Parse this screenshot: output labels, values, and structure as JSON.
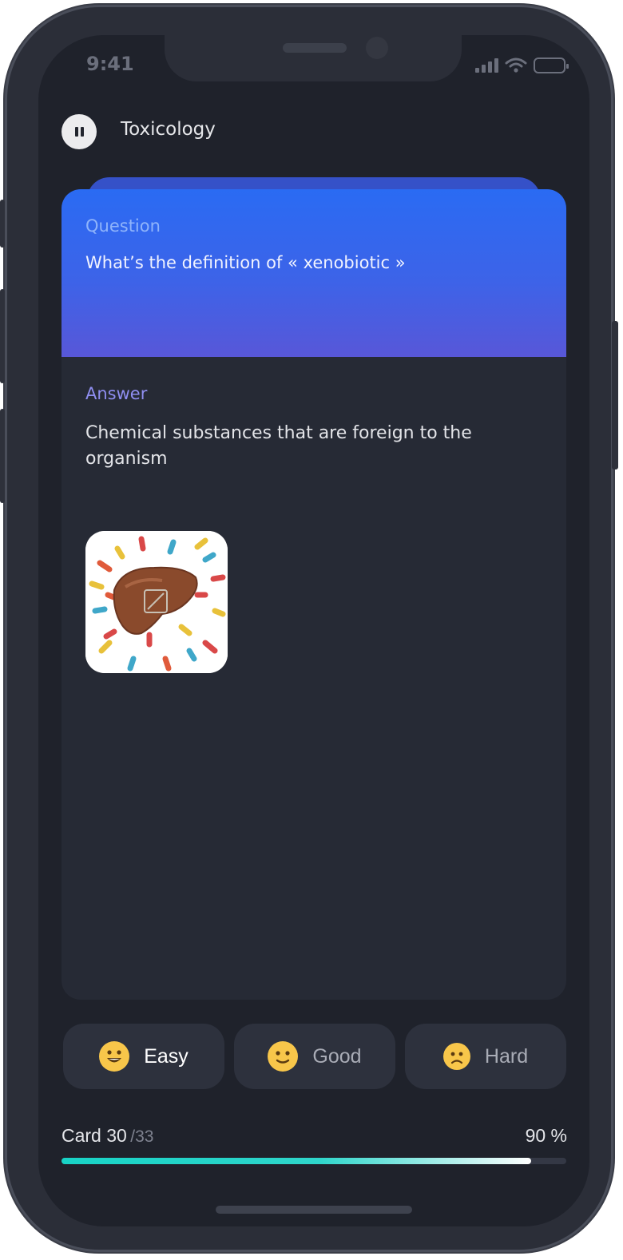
{
  "status_bar": {
    "time": "9:41",
    "icons": [
      "cellular-signal-icon",
      "wifi-icon",
      "battery-icon"
    ]
  },
  "header": {
    "pause_icon": "pause-icon",
    "deck_title": "Toxicology"
  },
  "card": {
    "question_label": "Question",
    "question_text": "What’s the definition of « xenobiotic »",
    "answer_label": "Answer",
    "answer_text": "Chemical substances that are foreign to the organism",
    "image_icon": "liver-with-pills-image"
  },
  "ratings": [
    {
      "label": "Easy",
      "icon": "grinning-face-icon",
      "color": "#ffffff"
    },
    {
      "label": "Good",
      "icon": "slight-smile-face-icon",
      "color": "#a9acb6"
    },
    {
      "label": "Hard",
      "icon": "frowning-face-icon",
      "color": "#a9acb6"
    }
  ],
  "progress": {
    "current_label": "Card 30",
    "total_label": "/33",
    "percent_label": "90 %",
    "fraction": 0.93
  },
  "colors": {
    "background": "#1f222b",
    "card": "#262a35",
    "question_gradient_top": "#2a6bf3",
    "question_gradient_bottom": "#5857d8",
    "answer_label": "#8f8ef0",
    "progress_fill": "#18d3c6",
    "emoji": "#f8c64a"
  }
}
